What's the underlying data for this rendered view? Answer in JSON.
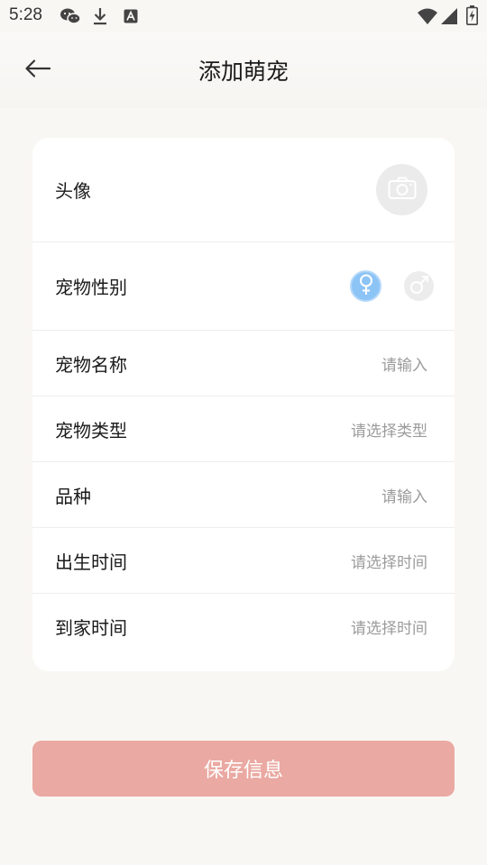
{
  "status_bar": {
    "time": "5:28"
  },
  "header": {
    "title": "添加萌宠"
  },
  "form": {
    "avatar_label": "头像",
    "gender_label": "宠物性别",
    "name_label": "宠物名称",
    "name_placeholder": "请输入",
    "type_label": "宠物类型",
    "type_placeholder": "请选择类型",
    "breed_label": "品种",
    "breed_placeholder": "请输入",
    "birth_label": "出生时间",
    "birth_placeholder": "请选择时间",
    "arrival_label": "到家时间",
    "arrival_placeholder": "请选择时间",
    "selected_gender": "female"
  },
  "save_button_label": "保存信息",
  "colors": {
    "background": "#f9f7f4",
    "card": "#ffffff",
    "accent_button": "#eaa9a2",
    "female_selected": "#8cc4f6",
    "placeholder": "#9b9b9b"
  }
}
